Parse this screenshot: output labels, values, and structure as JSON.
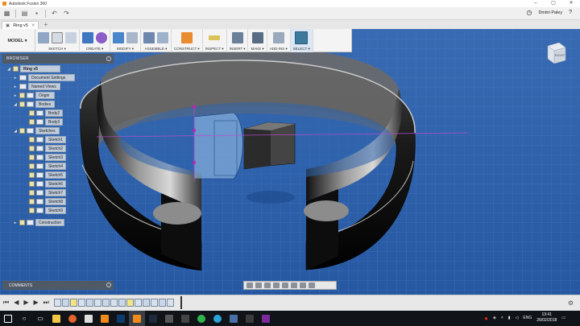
{
  "window": {
    "title": "Autodesk Fusion 360",
    "controls": [
      "–",
      "▢",
      "✕"
    ]
  },
  "qab": {
    "user_name": "Dmitri Paley"
  },
  "tabs": {
    "doc_tab": "Ring v5"
  },
  "toolbar": {
    "workspace": "MODEL ▾",
    "groups": [
      {
        "label": "SKETCH ▾"
      },
      {
        "label": "CREATE ▾"
      },
      {
        "label": "MODIFY ▾"
      },
      {
        "label": "ASSEMBLE ▾"
      },
      {
        "label": "CONSTRUCT ▾"
      },
      {
        "label": "INSPECT ▾"
      },
      {
        "label": "INSERT ▾"
      },
      {
        "label": "MAKE ▾"
      },
      {
        "label": "ADD-INS ▾"
      },
      {
        "label": "SELECT ▾"
      }
    ]
  },
  "browser": {
    "header": "BROWSER",
    "root": "Ring v5",
    "items": [
      {
        "label": "Document Settings"
      },
      {
        "label": "Named Views"
      },
      {
        "label": "Origin"
      },
      {
        "label": "Bodies"
      },
      {
        "label": "Body2"
      },
      {
        "label": "Body3"
      },
      {
        "label": "Sketches"
      },
      {
        "label": "Sketch1"
      },
      {
        "label": "Sketch2"
      },
      {
        "label": "Sketch3"
      },
      {
        "label": "Sketch4"
      },
      {
        "label": "Sketch5"
      },
      {
        "label": "Sketch6"
      },
      {
        "label": "Sketch7"
      },
      {
        "label": "Sketch8"
      },
      {
        "label": "Sketch9"
      },
      {
        "label": "Construction"
      }
    ]
  },
  "viewcube": {
    "face_label": "RIGHT"
  },
  "comments": {
    "header": "COMMENTS"
  },
  "taskbar": {
    "language": "ENG",
    "time": "13:41",
    "date": "26/02/2018"
  },
  "colors": {
    "viewport_bg": "#2b5fa8",
    "grid": "#4a7cc2",
    "accent": "#f08a1c"
  }
}
